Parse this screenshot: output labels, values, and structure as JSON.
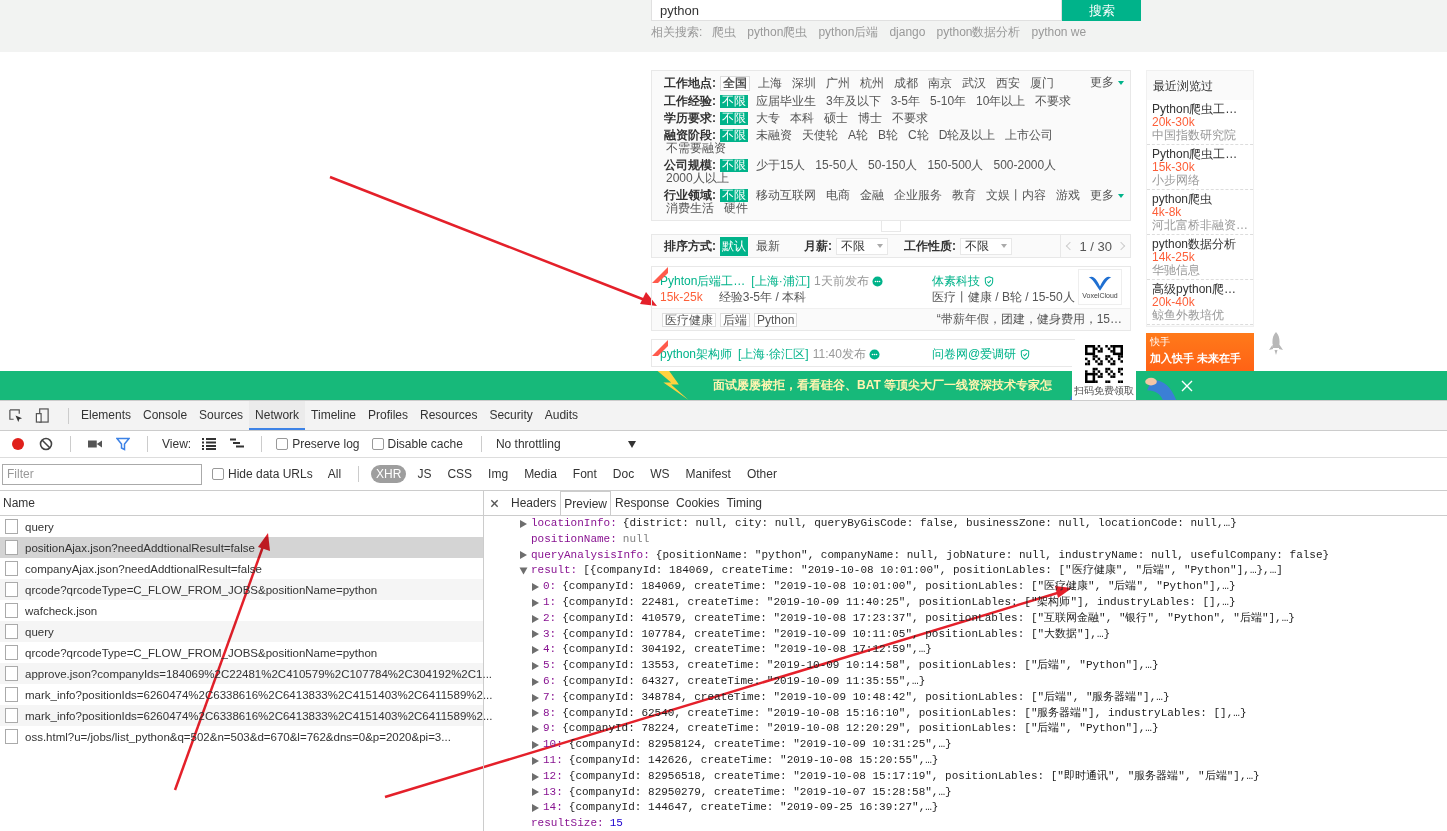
{
  "search": {
    "value": "python",
    "button": "搜索",
    "related_label": "相关搜索:",
    "related": [
      "爬虫",
      "python爬虫",
      "python后端",
      "django",
      "python数据分析",
      "python we"
    ]
  },
  "filters": [
    {
      "kind": "city",
      "label": "工作地点:",
      "more": "更多",
      "options": [
        {
          "text": "全国",
          "selected": true
        },
        {
          "text": "上海",
          "selected": false
        },
        {
          "text": "深圳",
          "selected": false
        },
        {
          "text": "广州",
          "selected": false
        },
        {
          "text": "杭州",
          "selected": false
        },
        {
          "text": "成都",
          "selected": false
        },
        {
          "text": "南京",
          "selected": false
        },
        {
          "text": "武汉",
          "selected": false
        },
        {
          "text": "西安",
          "selected": false
        },
        {
          "text": "厦门",
          "selected": false
        }
      ]
    },
    {
      "kind": "option",
      "label": "工作经验:",
      "options": [
        {
          "text": "不限",
          "selected": true
        },
        {
          "text": "应届毕业生",
          "selected": false
        },
        {
          "text": "3年及以下",
          "selected": false
        },
        {
          "text": "3-5年",
          "selected": false
        },
        {
          "text": "5-10年",
          "selected": false
        },
        {
          "text": "10年以上",
          "selected": false
        },
        {
          "text": "不要求",
          "selected": false
        }
      ]
    },
    {
      "kind": "option",
      "label": "学历要求:",
      "options": [
        {
          "text": "不限",
          "selected": true
        },
        {
          "text": "大专",
          "selected": false
        },
        {
          "text": "本科",
          "selected": false
        },
        {
          "text": "硕士",
          "selected": false
        },
        {
          "text": "博士",
          "selected": false
        },
        {
          "text": "不要求",
          "selected": false
        }
      ]
    },
    {
      "kind": "option",
      "label": "融资阶段:",
      "options": [
        {
          "text": "不限",
          "selected": true
        },
        {
          "text": "未融资",
          "selected": false
        },
        {
          "text": "天使轮",
          "selected": false
        },
        {
          "text": "A轮",
          "selected": false
        },
        {
          "text": "B轮",
          "selected": false
        },
        {
          "text": "C轮",
          "selected": false
        },
        {
          "text": "D轮及以上",
          "selected": false
        },
        {
          "text": "上市公司",
          "selected": false
        },
        {
          "text": "不需要融资",
          "selected": false
        }
      ]
    },
    {
      "kind": "option",
      "label": "公司规模:",
      "options": [
        {
          "text": "不限",
          "selected": true
        },
        {
          "text": "少于15人",
          "selected": false
        },
        {
          "text": "15-50人",
          "selected": false
        },
        {
          "text": "50-150人",
          "selected": false
        },
        {
          "text": "150-500人",
          "selected": false
        },
        {
          "text": "500-2000人",
          "selected": false
        },
        {
          "text": "2000人以上",
          "selected": false
        }
      ]
    },
    {
      "kind": "option",
      "label": "行业领域:",
      "more": "更多",
      "options": [
        {
          "text": "不限",
          "selected": true
        },
        {
          "text": "移动互联网",
          "selected": false
        },
        {
          "text": "电商",
          "selected": false
        },
        {
          "text": "金融",
          "selected": false
        },
        {
          "text": "企业服务",
          "selected": false
        },
        {
          "text": "教育",
          "selected": false
        },
        {
          "text": "文娱丨内容",
          "selected": false
        },
        {
          "text": "游戏",
          "selected": false
        },
        {
          "text": "消费生活",
          "selected": false
        },
        {
          "text": "硬件",
          "selected": false
        }
      ]
    }
  ],
  "sort_bar": {
    "label": "排序方式:",
    "options": [
      {
        "text": "默认",
        "selected": true
      },
      {
        "text": "最新",
        "selected": false
      }
    ],
    "salary_label": "月薪:",
    "salary_value": "不限",
    "nature_label": "工作性质:",
    "nature_value": "不限",
    "page": "1 / 30"
  },
  "jobs": [
    {
      "urgent": true,
      "title": "Pyhton后端工…",
      "location": "[上海·浦江]",
      "time": "1天前发布",
      "company": "体素科技",
      "company_info": "医疗丨健康 / B轮 / 15-50人",
      "salary": "15k-25k",
      "requirement": "经验3-5年 / 本科",
      "logo_text": "VoxelCloud",
      "tags": [
        "医疗健康",
        "后端",
        "Python"
      ],
      "benefit": "“带薪年假，团建，健身费用，15…"
    },
    {
      "urgent": true,
      "title": "python架构师",
      "location": "[上海·徐汇区]",
      "time": "11:40发布",
      "company": "问卷网@爱调研"
    }
  ],
  "recent": {
    "title": "最近浏览过",
    "items": [
      {
        "title": "Python爬虫工…",
        "salary": "20k-30k",
        "company": "中国指数研究院"
      },
      {
        "title": "Python爬虫工…",
        "salary": "15k-30k",
        "company": "小步网络"
      },
      {
        "title": "python爬虫",
        "salary": "4k-8k",
        "company": "河北富桥非融资…"
      },
      {
        "title": "python数据分析",
        "salary": "14k-25k",
        "company": "华驰信息"
      },
      {
        "title": "高级python爬…",
        "salary": "20k-40k",
        "company": "鲸鱼外教培优"
      }
    ]
  },
  "ad": {
    "brand": "快手",
    "headline": "加入快手 未来在手"
  },
  "banner": {
    "text": "面试屡屡被拒，看看硅谷、BAT 等顶尖大厂一线资深技术专家怎",
    "qr_caption": "扫码免费领取"
  },
  "devtools": {
    "tabs": [
      {
        "label": "Elements",
        "selected": false
      },
      {
        "label": "Console",
        "selected": false
      },
      {
        "label": "Sources",
        "selected": false
      },
      {
        "label": "Network",
        "selected": true
      },
      {
        "label": "Timeline",
        "selected": false
      },
      {
        "label": "Profiles",
        "selected": false
      },
      {
        "label": "Resources",
        "selected": false
      },
      {
        "label": "Security",
        "selected": false
      },
      {
        "label": "Audits",
        "selected": false
      }
    ],
    "toolbar": {
      "recording": true,
      "filter_on": true,
      "view_label": "View:",
      "preserve_log": {
        "label": "Preserve log",
        "checked": false
      },
      "disable_cache": {
        "label": "Disable cache",
        "checked": false
      },
      "throttling": "No throttling"
    },
    "filter_bar": {
      "placeholder": "Filter",
      "hide_data_urls": {
        "label": "Hide data URLs",
        "checked": false
      },
      "types": [
        {
          "label": "All",
          "selected": false
        },
        {
          "label": "XHR",
          "selected": true
        },
        {
          "label": "JS",
          "selected": false
        },
        {
          "label": "CSS",
          "selected": false
        },
        {
          "label": "Img",
          "selected": false
        },
        {
          "label": "Media",
          "selected": false
        },
        {
          "label": "Font",
          "selected": false
        },
        {
          "label": "Doc",
          "selected": false
        },
        {
          "label": "WS",
          "selected": false
        },
        {
          "label": "Manifest",
          "selected": false
        },
        {
          "label": "Other",
          "selected": false
        }
      ]
    },
    "requests": {
      "header": "Name",
      "items": [
        {
          "name": "query",
          "selected": false
        },
        {
          "name": "positionAjax.json?needAddtionalResult=false",
          "selected": true
        },
        {
          "name": "companyAjax.json?needAddtionalResult=false",
          "selected": false
        },
        {
          "name": "qrcode?qrcodeType=C_FLOW_FROM_JOBS&positionName=python",
          "selected": false
        },
        {
          "name": "wafcheck.json",
          "selected": false
        },
        {
          "name": "query",
          "selected": false
        },
        {
          "name": "qrcode?qrcodeType=C_FLOW_FROM_JOBS&positionName=python",
          "selected": false
        },
        {
          "name": "approve.json?companyIds=184069%2C22481%2C410579%2C107784%2C304192%2C1...",
          "selected": false
        },
        {
          "name": "mark_info?positionIds=6260474%2C6338616%2C6413833%2C4151403%2C6411589%2...",
          "selected": false
        },
        {
          "name": "mark_info?positionIds=6260474%2C6338616%2C6413833%2C4151403%2C6411589%2...",
          "selected": false
        },
        {
          "name": "oss.html?u=/jobs/list_python&q=502&n=503&d=670&l=762&dns=0&p=2020&pi=3...",
          "selected": false
        }
      ]
    },
    "detail_tabs": [
      {
        "label": "Headers",
        "selected": false
      },
      {
        "label": "Preview",
        "selected": true
      },
      {
        "label": "Response",
        "selected": false
      },
      {
        "label": "Cookies",
        "selected": false
      },
      {
        "label": "Timing",
        "selected": false
      }
    ],
    "preview": [
      {
        "kind": "object",
        "expanded": false,
        "key": "locationInfo:",
        "value": "{district: null, city: null, queryByGisCode: false, businessZone: null, locationCode: null,…}"
      },
      {
        "kind": "null",
        "key": "positionName:",
        "value": "null"
      },
      {
        "kind": "object",
        "expanded": false,
        "key": "queryAnalysisInfo:",
        "value": "{positionName: \"python\", companyName: null, jobNature: null, industryName: null, usefulCompany: false}"
      },
      {
        "kind": "object",
        "expanded": true,
        "key": "result:",
        "value": "[{companyId: 184069, createTime: \"2019-10-08 10:01:00\", positionLables: [\"医疗健康\", \"后端\", \"Python\"],…},…]",
        "children": [
          {
            "kind": "object",
            "expanded": false,
            "key": "0:",
            "value": "{companyId: 184069, createTime: \"2019-10-08 10:01:00\", positionLables: [\"医疗健康\", \"后端\", \"Python\"],…}"
          },
          {
            "kind": "object",
            "expanded": false,
            "key": "1:",
            "value": "{companyId: 22481, createTime: \"2019-10-09 11:40:25\", positionLables: [\"架构师\"], industryLables: [],…}"
          },
          {
            "kind": "object",
            "expanded": false,
            "key": "2:",
            "value": "{companyId: 410579, createTime: \"2019-10-08 17:23:37\", positionLables: [\"互联网金融\", \"银行\", \"Python\", \"后端\"],…}"
          },
          {
            "kind": "object",
            "expanded": false,
            "key": "3:",
            "value": "{companyId: 107784, createTime: \"2019-10-09 10:11:05\", positionLables: [\"大数据\"],…}"
          },
          {
            "kind": "object",
            "expanded": false,
            "key": "4:",
            "value": "{companyId: 304192, createTime: \"2019-10-08 17:12:59\",…}"
          },
          {
            "kind": "object",
            "expanded": false,
            "key": "5:",
            "value": "{companyId: 13553, createTime: \"2019-10-09 10:14:58\", positionLables: [\"后端\", \"Python\"],…}"
          },
          {
            "kind": "object",
            "expanded": false,
            "key": "6:",
            "value": "{companyId: 64327, createTime: \"2019-10-09 11:35:55\",…}"
          },
          {
            "kind": "object",
            "expanded": false,
            "key": "7:",
            "value": "{companyId: 348784, createTime: \"2019-10-09 10:48:42\", positionLables: [\"后端\", \"服务器端\"],…}"
          },
          {
            "kind": "object",
            "expanded": false,
            "key": "8:",
            "value": "{companyId: 62540, createTime: \"2019-10-08 15:16:10\", positionLables: [\"服务器端\"], industryLables: [],…}"
          },
          {
            "kind": "object",
            "expanded": false,
            "key": "9:",
            "value": "{companyId: 78224, createTime: \"2019-10-08 12:20:29\", positionLables: [\"后端\", \"Python\"],…}"
          },
          {
            "kind": "object",
            "expanded": false,
            "key": "10:",
            "value": "{companyId: 82958124, createTime: \"2019-10-09 10:31:25\",…}"
          },
          {
            "kind": "object",
            "expanded": false,
            "key": "11:",
            "value": "{companyId: 142626, createTime: \"2019-10-08 15:20:55\",…}"
          },
          {
            "kind": "object",
            "expanded": false,
            "key": "12:",
            "value": "{companyId: 82956518, createTime: \"2019-10-08 15:17:19\", positionLables: [\"即时通讯\", \"服务器端\", \"后端\"],…}"
          },
          {
            "kind": "object",
            "expanded": false,
            "key": "13:",
            "value": "{companyId: 82950279, createTime: \"2019-10-07 15:28:58\",…}"
          },
          {
            "kind": "object",
            "expanded": false,
            "key": "14:",
            "value": "{companyId: 144647, createTime: \"2019-09-25 16:39:27\",…}"
          }
        ]
      },
      {
        "kind": "number",
        "key": "resultSize:",
        "value": "15"
      }
    ]
  }
}
